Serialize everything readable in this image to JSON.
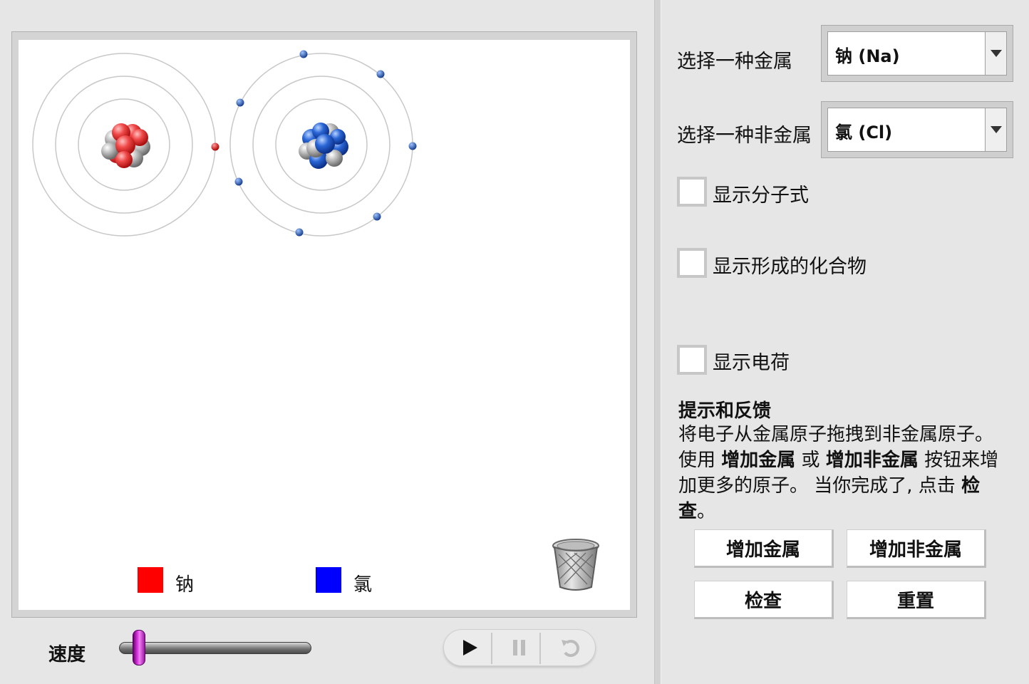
{
  "simulation": {
    "legend": [
      {
        "label": "钠",
        "color": "#ff0000"
      },
      {
        "label": "氯",
        "color": "#0000ff"
      }
    ],
    "colors": {
      "sodium_electron": "#e01010",
      "chlorine_electron": "#1f55b0",
      "orbit": "#c8c8c8"
    },
    "icons": {
      "trash": "trash-can-icon"
    }
  },
  "controls": {
    "speed_label": "速度",
    "speed_value_fraction": 0.1,
    "play_icon": "play-icon",
    "pause_icon": "pause-icon",
    "step_back_icon": "step-back-icon"
  },
  "panel": {
    "metal_label": "选择一种金属",
    "metal_selected": "钠 (Na)",
    "nonmetal_label": "选择一种非金属",
    "nonmetal_selected": "氯 (Cl)",
    "checkboxes": [
      {
        "label": "显示分子式",
        "checked": false
      },
      {
        "label": "显示形成的化合物",
        "checked": false
      },
      {
        "label": "显示电荷",
        "checked": false
      }
    ],
    "hint_title": "提示和反馈",
    "hint_line1": "将电子从金属原子拖拽到非金属原子。",
    "hint_use": "使用 ",
    "hint_add_metal": "增加金属",
    "hint_or": " 或 ",
    "hint_add_nonmetal": "增加非金属",
    "hint_more": " 按钮来增加更多的原子。 当你完成了, 点击 ",
    "hint_check": "检查",
    "hint_end": "。",
    "buttons": {
      "add_metal": "增加金属",
      "add_nonmetal": "增加非金属",
      "check": "检查",
      "reset": "重置"
    }
  }
}
